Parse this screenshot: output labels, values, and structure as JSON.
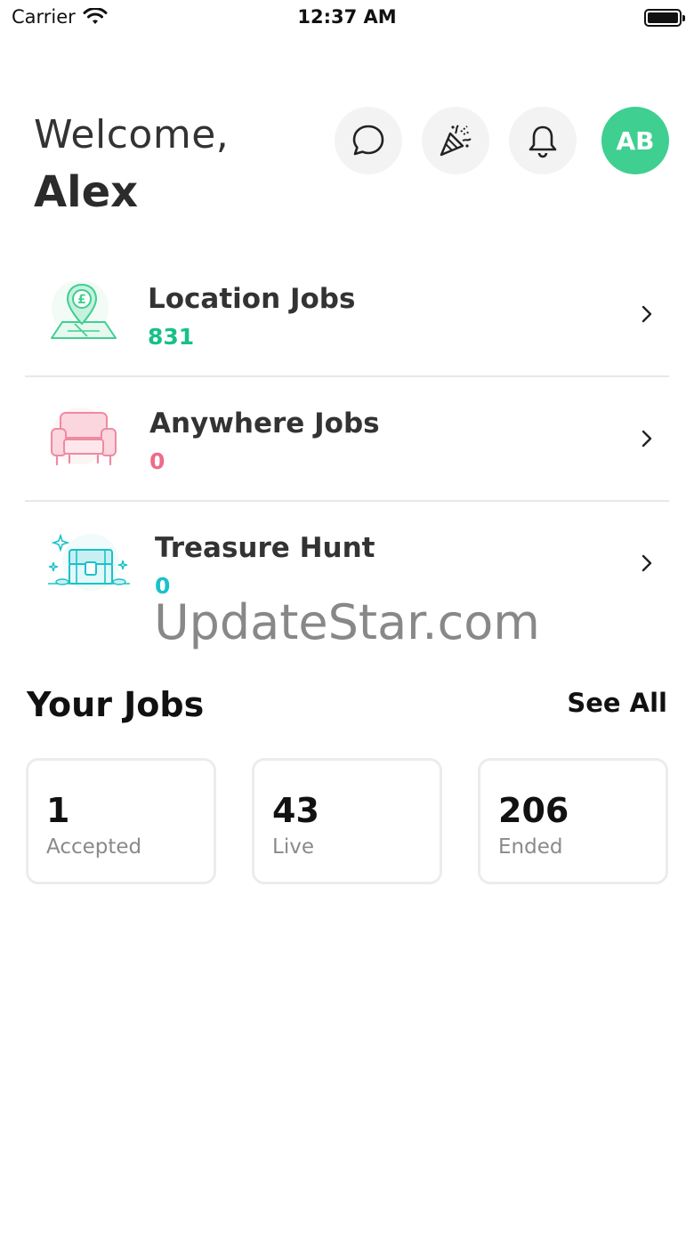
{
  "status_bar": {
    "carrier": "Carrier",
    "time": "12:37 AM"
  },
  "header": {
    "welcome": "Welcome,",
    "name": "Alex",
    "avatar_initials": "AB",
    "icons": [
      "chat-icon",
      "party-popper-icon",
      "bell-icon"
    ]
  },
  "categories": [
    {
      "title": "Location Jobs",
      "count": "831",
      "color": "#17c08a",
      "icon": "location-pin-pound-icon"
    },
    {
      "title": "Anywhere Jobs",
      "count": "0",
      "color": "#ef6b8a",
      "icon": "armchair-icon"
    },
    {
      "title": "Treasure Hunt",
      "count": "0",
      "color": "#19c2c9",
      "icon": "treasure-chest-icon"
    }
  ],
  "watermark": "UpdateStar.com",
  "your_jobs": {
    "title": "Your Jobs",
    "see_all": "See All",
    "stats": [
      {
        "value": "1",
        "label": "Accepted"
      },
      {
        "value": "43",
        "label": "Live"
      },
      {
        "value": "206",
        "label": "Ended"
      }
    ]
  },
  "colors": {
    "accent_green": "#3fcf91",
    "card_border": "#ececec"
  }
}
